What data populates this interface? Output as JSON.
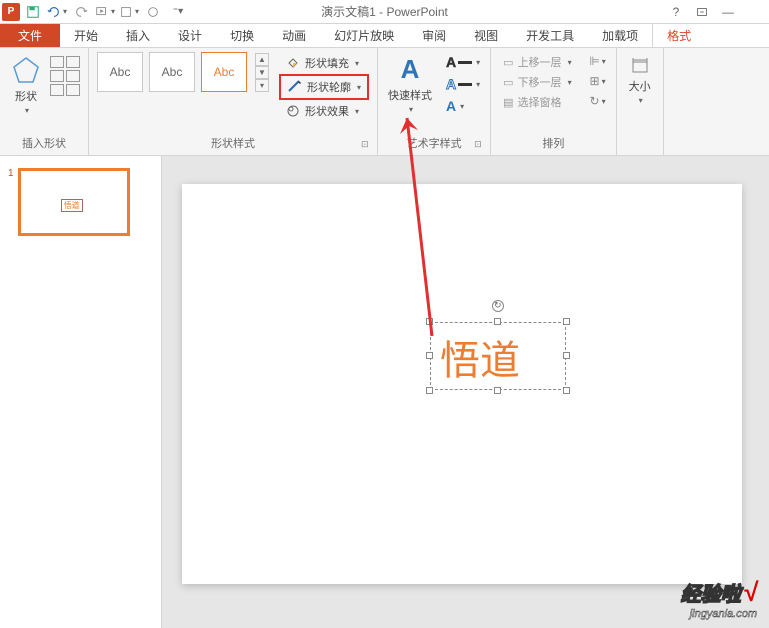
{
  "title": "演示文稿1 - PowerPoint",
  "tabs": {
    "file": "文件",
    "home": "开始",
    "insert": "插入",
    "design": "设计",
    "transitions": "切换",
    "animations": "动画",
    "slideshow": "幻灯片放映",
    "review": "审阅",
    "view": "视图",
    "developer": "开发工具",
    "addins": "加载项",
    "format": "格式"
  },
  "ribbon": {
    "insert_shapes": {
      "shape_label": "形状",
      "group_label": "插入形状"
    },
    "shape_styles": {
      "abc": "Abc",
      "fill": "形状填充",
      "outline": "形状轮廓",
      "effects": "形状效果",
      "group_label": "形状样式"
    },
    "wordart": {
      "quick_style": "快速样式",
      "a_glyph": "A",
      "group_label": "艺术字样式"
    },
    "arrange": {
      "bring_forward": "上移一层",
      "send_backward": "下移一层",
      "selection_pane": "选择窗格",
      "group_label": "排列"
    },
    "size": {
      "label": "大小"
    }
  },
  "slide": {
    "number": "1",
    "thumb_text": "悟道",
    "textbox_content": "悟道"
  },
  "watermark": {
    "main": "经验啦",
    "check": "√",
    "sub": "jingyanla.com"
  }
}
